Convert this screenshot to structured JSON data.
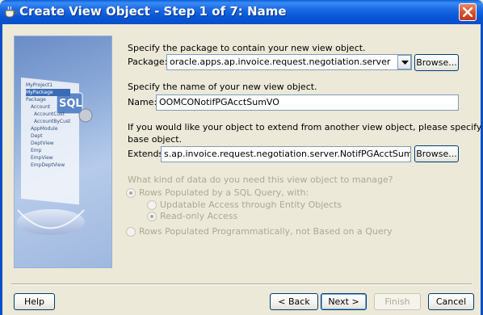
{
  "window": {
    "title": "Create View Object - Step 1 of 7: Name",
    "title_icon": "cup-icon",
    "close_icon": "close-icon"
  },
  "image_panel": {
    "sql_badge": "SQL",
    "tree_items": [
      "MyProject1",
      "MyPackage",
      "Package",
      "Account",
      "AccountCust",
      "AccountByCust",
      "AppModule",
      "Dept",
      "DeptView",
      "Emp",
      "EmpView",
      "EmpDeptView"
    ]
  },
  "package_section": {
    "instruction": "Specify the package to contain your new view object.",
    "label": "Package:",
    "value": "oracle.apps.ap.invoice.request.negotiation.server",
    "browse_label": "Browse..."
  },
  "name_section": {
    "instruction": "Specify the name of your new view object.",
    "label": "Name:",
    "value": "OOMCONotifPGAcctSumVO"
  },
  "extends_section": {
    "instruction_line1": "If you would like your object to extend from another view object, please specify the",
    "instruction_line2": "base object.",
    "label": "Extends:",
    "value": "s.ap.invoice.request.negotiation.server.NotifPGAcctSumVO",
    "browse_label": "Browse..."
  },
  "data_kind": {
    "question": "What kind of data do you need this view object to manage?",
    "option_sql": "Rows Populated by a SQL Query, with:",
    "option_updatable": "Updatable Access through Entity Objects",
    "option_readonly": "Read-only Access",
    "option_programmatic": "Rows Populated Programmatically, not Based on a Query",
    "selected_primary": "option_sql",
    "selected_secondary": "option_readonly"
  },
  "footer": {
    "help_label": "Help",
    "back_label": "< Back",
    "next_label": "Next >",
    "finish_label": "Finish",
    "cancel_label": "Cancel"
  }
}
